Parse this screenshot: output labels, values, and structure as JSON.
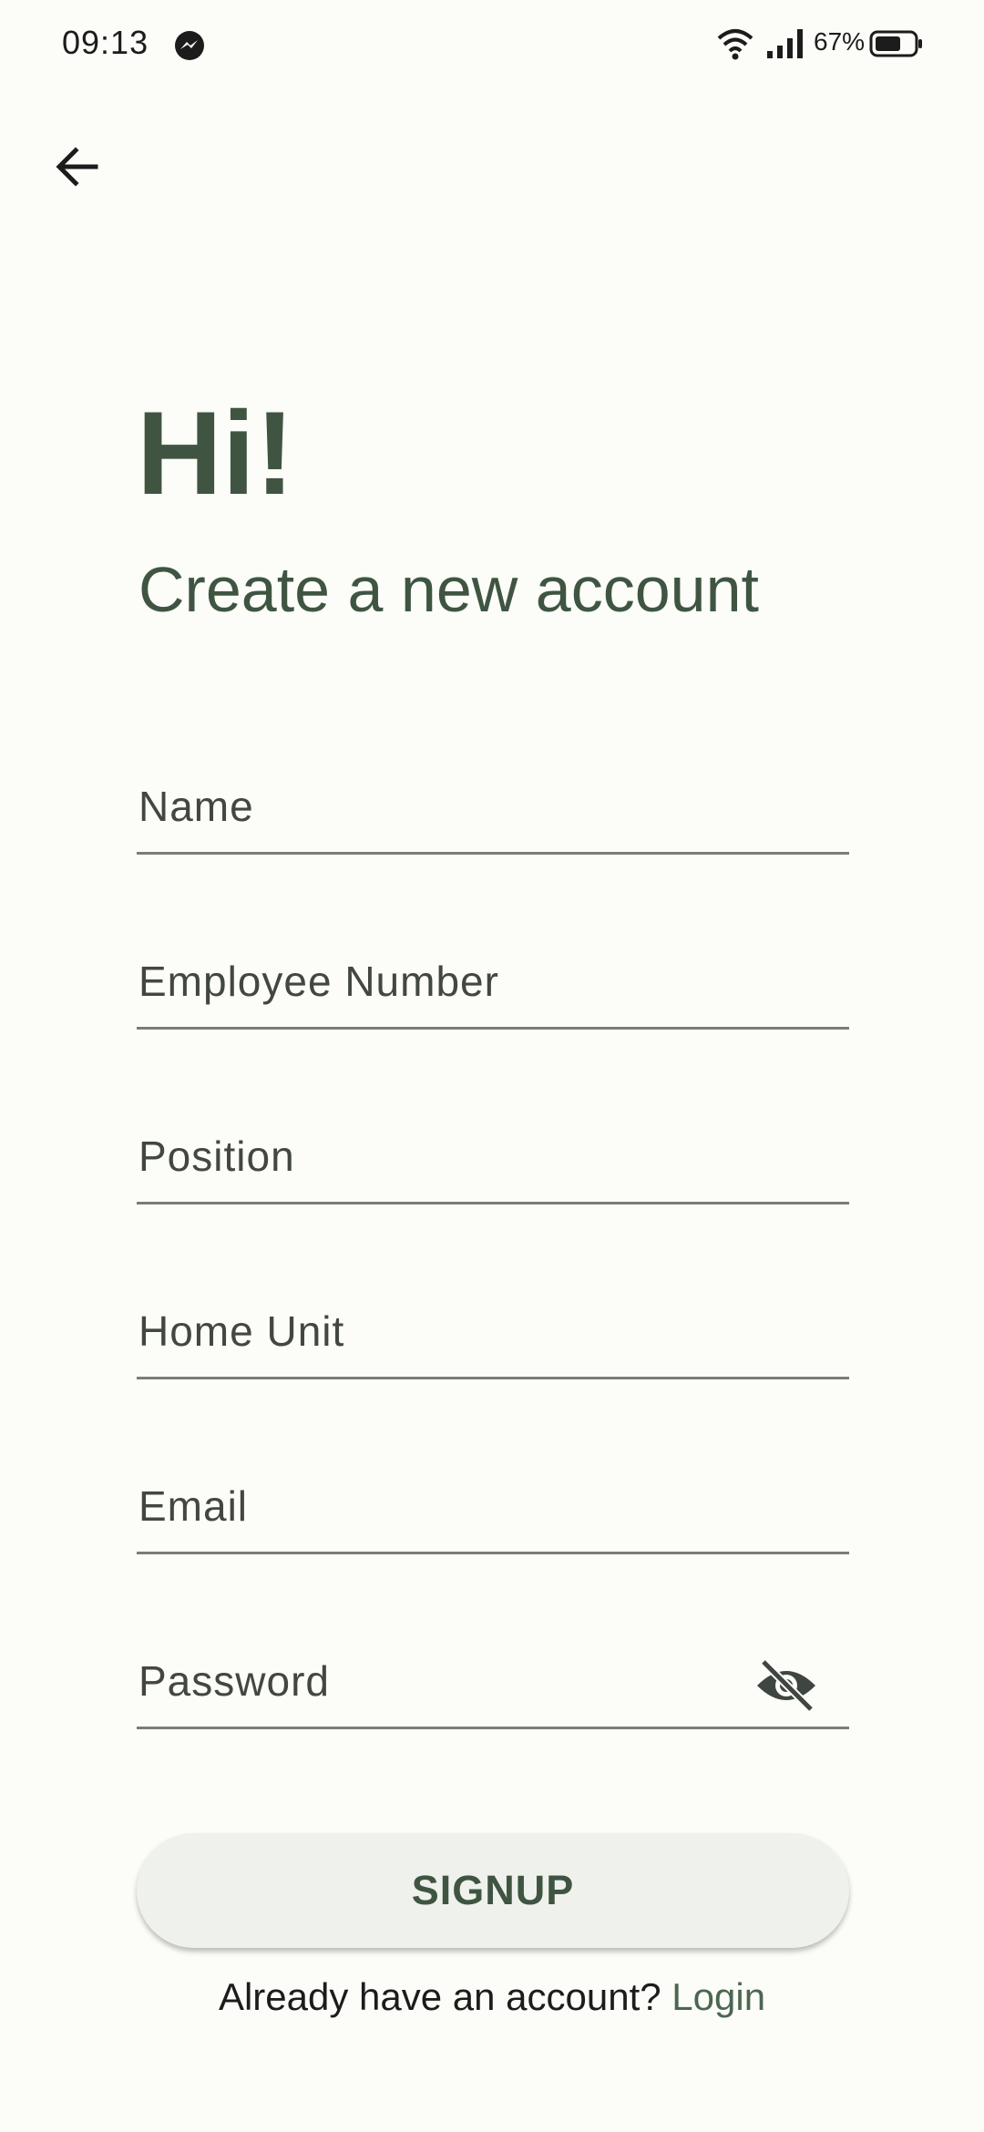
{
  "status_bar": {
    "time": "09:13",
    "battery_percent": "67%",
    "battery_level": 0.67,
    "icons": [
      "messenger-icon",
      "wifi-icon",
      "signal-icon",
      "battery-icon"
    ]
  },
  "nav": {
    "back_icon": "arrow-back-icon"
  },
  "header": {
    "greeting": "Hi!",
    "subtitle": "Create a new account"
  },
  "form": {
    "fields": [
      {
        "label": "Name",
        "value": ""
      },
      {
        "label": "Employee Number",
        "value": ""
      },
      {
        "label": "Position",
        "value": ""
      },
      {
        "label": "Home Unit",
        "value": ""
      },
      {
        "label": "Email",
        "value": ""
      },
      {
        "label": "Password",
        "value": "",
        "toggle_icon": "visibility-off-icon"
      }
    ],
    "signup_label": "SIGNUP"
  },
  "footer": {
    "prompt": "Already have an account?",
    "login_label": "Login"
  },
  "colors": {
    "background": "#fcfcf8",
    "primary": "#3f5542",
    "link": "#4c6650",
    "button_bg": "#eff2ec",
    "underline": "#7b7b77"
  }
}
